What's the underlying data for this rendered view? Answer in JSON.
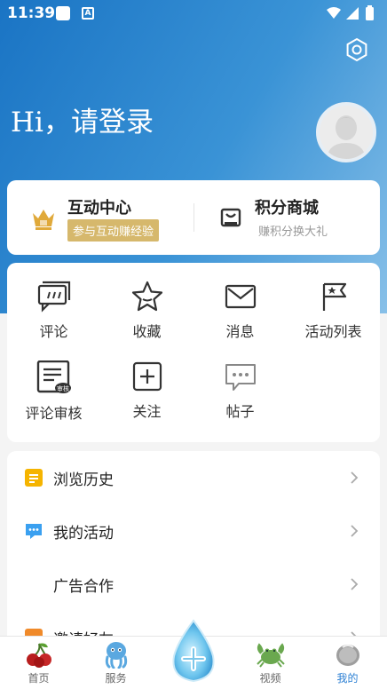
{
  "status_bar": {
    "time": "11:39"
  },
  "header": {
    "greeting": "Hi，请登录"
  },
  "interaction_center": {
    "title": "互动中心",
    "badge": "参与互动赚经验"
  },
  "points_mall": {
    "title": "积分商城",
    "subtitle": "赚积分换大礼"
  },
  "grid": {
    "comment": "评论",
    "favorite": "收藏",
    "message": "消息",
    "activity_list": "活动列表",
    "comment_review": "评论审核",
    "review_badge": "审核",
    "follow": "关注",
    "posts": "帖子"
  },
  "list": {
    "history": "浏览历史",
    "my_activity": "我的活动",
    "ad_cooperation": "广告合作",
    "invite_friends": "邀请好友"
  },
  "tabbar": {
    "home": "首页",
    "service": "服务",
    "video": "视频",
    "mine": "我的"
  },
  "colors": {
    "accent": "#2b7fd3",
    "gold": "#d6b86c",
    "hero_start": "#1a74c4",
    "hero_end": "#88c0e8"
  }
}
